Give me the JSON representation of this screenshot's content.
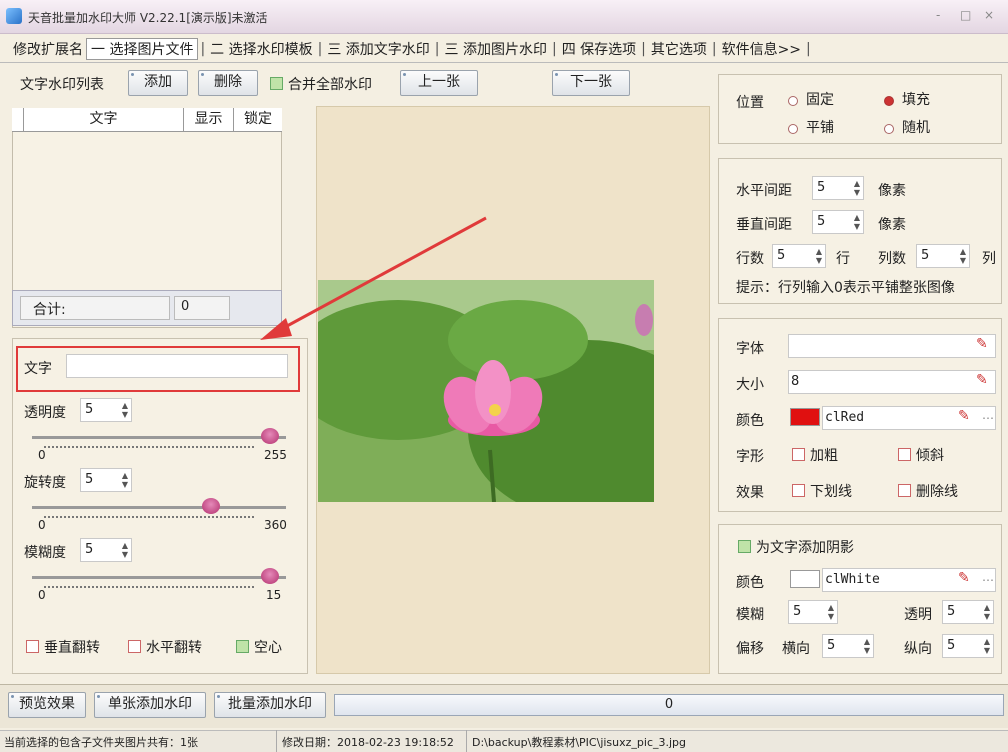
{
  "window": {
    "title": "天音批量加水印大师 V2.22.1[演示版]未激活",
    "controls": [
      "-",
      "□",
      "×"
    ]
  },
  "tabs": [
    {
      "label": "修改扩展名"
    },
    {
      "label": "一 选择图片文件",
      "active": true
    },
    {
      "label": "二 选择水印模板"
    },
    {
      "label": "三 添加文字水印"
    },
    {
      "label": "三 添加图片水印"
    },
    {
      "label": "四 保存选项"
    },
    {
      "label": "其它选项"
    },
    {
      "label": "软件信息>>"
    }
  ],
  "watermark_list": {
    "title": "文字水印列表",
    "add": "添加",
    "delete": "删除",
    "merge_all": "合并全部水印",
    "prev": "上一张",
    "next": "下一张",
    "columns": [
      "文字",
      "显示",
      "锁定"
    ],
    "total_label": "合计:",
    "total_value": "0"
  },
  "text_props": {
    "text_label": "文字",
    "text_value": "",
    "opacity_label": "透明度",
    "opacity_value": "5",
    "opacity_min": "0",
    "opacity_max": "255",
    "opacity_fraction": 0.97,
    "rotation_label": "旋转度",
    "rotation_value": "5",
    "rotation_min": "0",
    "rotation_max": "360",
    "rotation_fraction": 0.72,
    "blur_label": "模糊度",
    "blur_value": "5",
    "blur_min": "0",
    "blur_max": "15",
    "blur_fraction": 0.97,
    "flip_v": "垂直翻转",
    "flip_h": "水平翻转",
    "hollow": "空心"
  },
  "position": {
    "label": "位置",
    "fixed": "固定",
    "fill": "填充",
    "tile": "平铺",
    "random": "随机",
    "selected": "fill"
  },
  "spacing": {
    "h_label": "水平间距",
    "h_value": "5",
    "h_unit": "像素",
    "v_label": "垂直间距",
    "v_value": "5",
    "v_unit": "像素",
    "rows_label": "行数",
    "rows_value": "5",
    "rows_unit": "行",
    "cols_label": "列数",
    "cols_value": "5",
    "cols_unit": "列",
    "tip": "提示：行列输入0表示平铺整张图像"
  },
  "font": {
    "font_label": "字体",
    "font_value": "",
    "size_label": "大小",
    "size_value": "8",
    "color_label": "颜色",
    "color_value": "clRed",
    "color_swatch": "#e01010",
    "style_label": "字形",
    "bold": "加粗",
    "italic": "倾斜",
    "effect_label": "效果",
    "underline": "下划线",
    "strikeout": "删除线"
  },
  "shadow": {
    "enable": "为文字添加阴影",
    "color_label": "颜色",
    "color_value": "clWhite",
    "color_swatch": "#ffffff",
    "blur_label": "模糊",
    "blur_value": "5",
    "opacity_label": "透明",
    "opacity_value": "5",
    "offset_label": "偏移",
    "offset_h_label": "横向",
    "offset_h_value": "5",
    "offset_v_label": "纵向",
    "offset_v_value": "5"
  },
  "actions": {
    "preview": "预览效果",
    "single": "单张添加水印",
    "batch": "批量添加水印",
    "progress": "0"
  },
  "status": {
    "count": "当前选择的包含子文件夹图片共有：1张",
    "modified": "修改日期：2018-02-23 19:18:52",
    "path": "D:\\backup\\教程素材\\PIC\\jisuxz_pic_3.jpg"
  },
  "colors": {
    "highlight_box": "#e03a3a",
    "arrow": "#e03a3a"
  }
}
